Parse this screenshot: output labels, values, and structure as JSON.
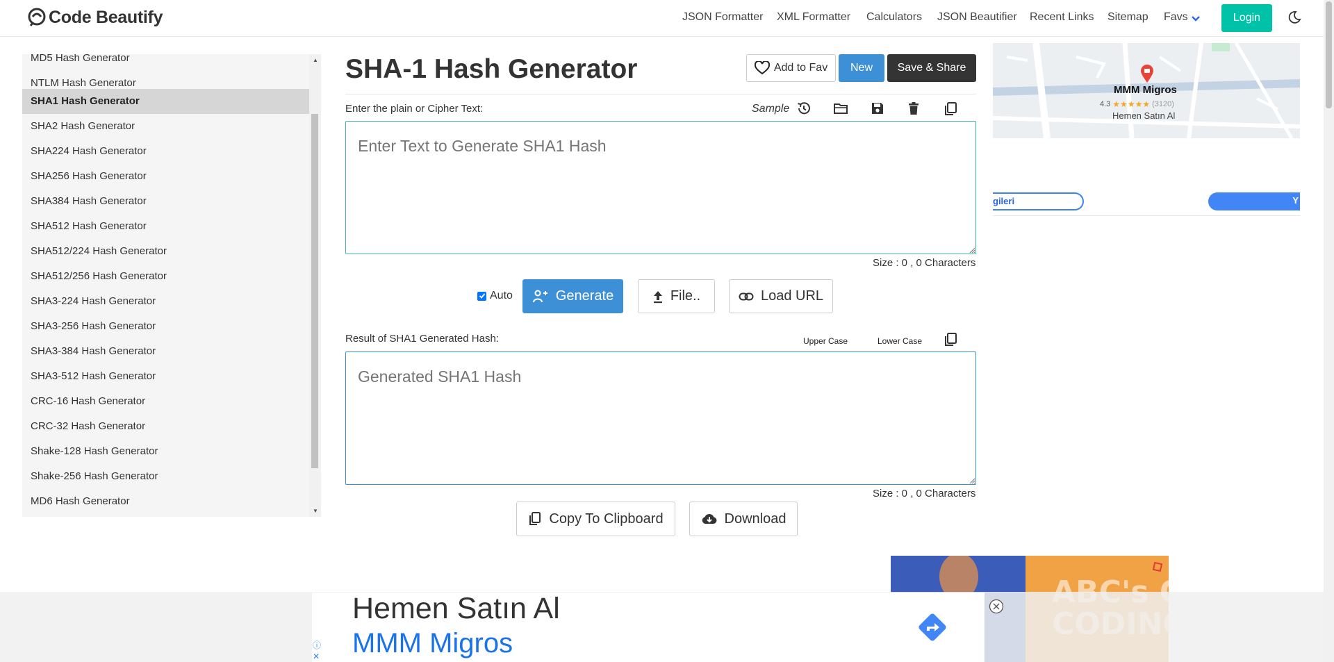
{
  "brand": {
    "name": "Code Beautify"
  },
  "nav": {
    "links": [
      "JSON Formatter",
      "XML Formatter",
      "Calculators",
      "JSON Beautifier",
      "Recent Links",
      "Sitemap",
      "Favs"
    ],
    "login": "Login"
  },
  "sidebar": {
    "items": [
      {
        "label": "MD5 Hash Generator"
      },
      {
        "label": "NTLM Hash Generator"
      },
      {
        "label": "SHA1 Hash Generator",
        "active": true
      },
      {
        "label": "SHA2 Hash Generator"
      },
      {
        "label": "SHA224 Hash Generator"
      },
      {
        "label": "SHA256 Hash Generator"
      },
      {
        "label": "SHA384 Hash Generator"
      },
      {
        "label": "SHA512 Hash Generator"
      },
      {
        "label": "SHA512/224 Hash Generator"
      },
      {
        "label": "SHA512/256 Hash Generator"
      },
      {
        "label": "SHA3-224 Hash Generator"
      },
      {
        "label": "SHA3-256 Hash Generator"
      },
      {
        "label": "SHA3-384 Hash Generator"
      },
      {
        "label": "SHA3-512 Hash Generator"
      },
      {
        "label": "CRC-16 Hash Generator"
      },
      {
        "label": "CRC-32 Hash Generator"
      },
      {
        "label": "Shake-128 Hash Generator"
      },
      {
        "label": "Shake-256 Hash Generator"
      },
      {
        "label": "MD6 Hash Generator"
      }
    ]
  },
  "main": {
    "title": "SHA-1 Hash Generator",
    "buttons": {
      "add_fav": "Add to Fav",
      "new": "New",
      "save_share": "Save & Share"
    },
    "input": {
      "label": "Enter the plain or Cipher Text:",
      "sample": "Sample",
      "placeholder": "Enter Text to Generate SHA1 Hash",
      "size": "Size : 0 , 0 Characters"
    },
    "actions": {
      "auto": "Auto",
      "generate": "Generate",
      "file": "File..",
      "load_url": "Load URL"
    },
    "output": {
      "label": "Result of SHA1 Generated Hash:",
      "upper_case": "Upper Case",
      "lower_case": "Lower Case",
      "placeholder": "Generated SHA1 Hash",
      "size": "Size : 0 , 0 Characters"
    },
    "bottom_buttons": {
      "copy": "Copy To Clipboard",
      "download": "Download"
    }
  },
  "ads": {
    "map": {
      "title": "MMM Migros",
      "rating": "4.3",
      "reviews": "(3120)",
      "subtitle": "Hemen Satın Al"
    },
    "pills": {
      "left": "gileri",
      "right": "Y"
    },
    "banner": {
      "line1": "Hemen Satın Al",
      "line2": "MMM Migros"
    },
    "video": {
      "text": "ABC's OF CODING"
    }
  },
  "colors": {
    "accent": "#3d8fd6",
    "login": "#00c2a8",
    "dark_button": "#343434",
    "input_border": "#46b3a6"
  }
}
